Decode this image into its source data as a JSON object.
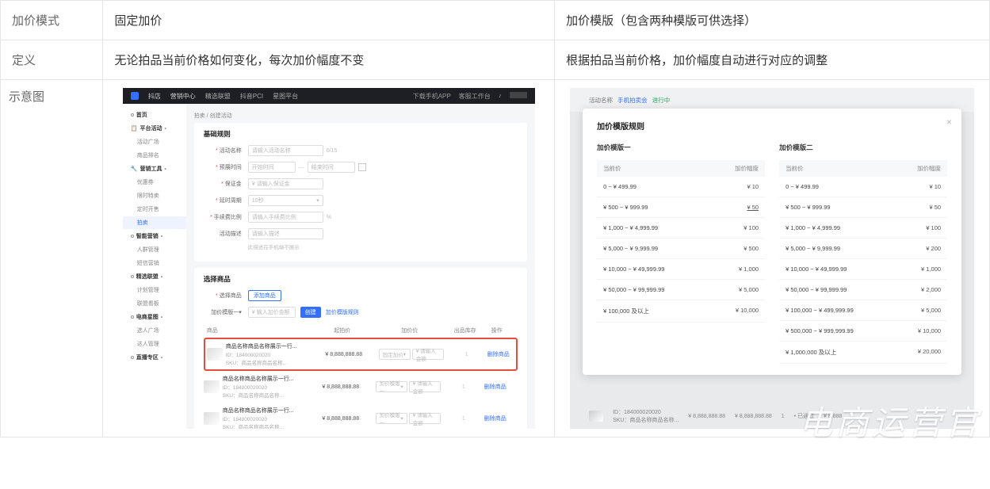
{
  "rows": {
    "mode_label": "加价模式",
    "def_label": "定义",
    "diagram_label": "示意图"
  },
  "colA": {
    "mode": "固定加价",
    "definition": "无论拍品当前价格如何变化，每次加价幅度不变"
  },
  "colB": {
    "mode": "加价模版（包含两种模版可供选择）",
    "definition": "根据拍品当前价格，加价幅度自动进行对应的调整"
  },
  "shotA": {
    "brand": "抖店",
    "brand_sub": "营销中心",
    "topnav": [
      "精选联盟",
      "抖音PCI",
      "星图平台"
    ],
    "topright": [
      "下载手机APP",
      "客服工作台"
    ],
    "sidebar": {
      "home": "首页",
      "group1": "平台活动",
      "g1_items": [
        "活动广场",
        "商品排名"
      ],
      "group2": "营销工具",
      "g2_items": [
        "优惠券",
        "限时特卖",
        "定时开售",
        "拍卖"
      ],
      "selected": "拍卖",
      "group3": "智能营销",
      "g3_items": [
        "人群管理",
        "短信营销"
      ],
      "group4": "精选联盟",
      "g4_items": [
        "计划管理",
        "联盟看板"
      ],
      "group5": "电商星图",
      "g5_items": [
        "选人广场",
        "达人管理"
      ],
      "group6": "直播专区"
    },
    "crumbs": "拍卖 / 创建活动",
    "card1_title": "基础规则",
    "form": {
      "f1_label": "活动名称",
      "f1_ph": "请输入活动名称",
      "f1_cnt": "0/15",
      "f2_label": "预展时间",
      "f2_ph1": "开始时间",
      "f2_ph2": "结束时间",
      "f3_label": "保证金",
      "f3_ph": "¥ 请输入保证金",
      "f4_label": "延时周期",
      "f4_val": "10秒",
      "f5_label": "手续费比例",
      "f5_ph": "请输入手续费比例",
      "f5_unit": "%",
      "f6_label": "活动描述",
      "f6_ph": "请输入描述",
      "f6_hint": "此描述在手机端不展示"
    },
    "card2_title": "选择商品",
    "card2": {
      "goods_label": "选择商品",
      "goods_btn": "添加商品",
      "tpl_label": "加价模版一",
      "tpl_input_ph": "¥ 输入加价金额",
      "create_btn": "创建",
      "rule_link": "加价模版规则"
    },
    "tbl_headers": [
      "商品",
      "起拍价",
      "加价价",
      "出品库存",
      "操作"
    ],
    "product": {
      "title": "商品名称商品名称展示一行...",
      "id_line": "ID：184000020020",
      "sku_line": "SKU：商品名称商品名称...",
      "price": "¥ 8,888,888.88",
      "sel_fixed": "固定加价",
      "sel_tpl": "加价模版一",
      "sel_ph": "¥ 请输入金额",
      "qty": "1",
      "op": "删除商品"
    }
  },
  "shotB": {
    "bg_label": "活动名称",
    "bg_name": "手机拍卖会",
    "bg_tag": "进行中",
    "modal_title": "加价模版规则",
    "close": "×",
    "col1_title": "加价模版一",
    "col2_title": "加价模版二",
    "th_price": "当前价",
    "th_step": "加价幅度",
    "col1_rows": [
      {
        "range": "0 ~ ¥ 499.99",
        "step": "¥ 10"
      },
      {
        "range": "¥ 500 ~ ¥ 999.99",
        "step": "¥ 50",
        "blue": true
      },
      {
        "range": "¥ 1,000 ~ ¥ 4,999.99",
        "step": "¥ 100"
      },
      {
        "range": "¥ 5,000 ~ ¥ 9,999.99",
        "step": "¥ 500"
      },
      {
        "range": "¥ 10,000 ~ ¥ 49,999.99",
        "step": "¥ 1,000"
      },
      {
        "range": "¥ 50,000 ~ ¥ 99,999.99",
        "step": "¥ 5,000"
      },
      {
        "range": "¥ 100,000 及以上",
        "step": "¥ 10,000"
      }
    ],
    "col2_rows": [
      {
        "range": "0 ~ ¥ 499.99",
        "step": "¥ 10"
      },
      {
        "range": "¥ 500 ~ ¥ 999.99",
        "step": "¥ 50"
      },
      {
        "range": "¥ 1,000 ~ ¥ 4,999.99",
        "step": "¥ 100"
      },
      {
        "range": "¥ 5,000 ~ ¥ 9,999.99",
        "step": "¥ 200"
      },
      {
        "range": "¥ 10,000 ~ ¥ 49,999.99",
        "step": "¥ 1,000"
      },
      {
        "range": "¥ 50,000 ~ ¥ 99,999.99",
        "step": "¥ 2,000"
      },
      {
        "range": "¥ 100,000 ~ ¥ 499,999.99",
        "step": "¥ 5,000"
      },
      {
        "range": "¥ 500,000 ~ ¥ 999,999.99",
        "step": "¥ 10,000"
      },
      {
        "range": "¥ 1,000,000 及以上",
        "step": "¥ 20,000"
      }
    ],
    "bg_row": {
      "id": "ID：184000020020",
      "sku": "SKU：商品名称商品名称...",
      "p1": "¥ 8,888,888.88",
      "p2": "¥ 8,888,888.88",
      "qty": "1",
      "status": "• 已通过",
      "p3": "¥ 8,888"
    }
  },
  "watermark": "电商运营官"
}
